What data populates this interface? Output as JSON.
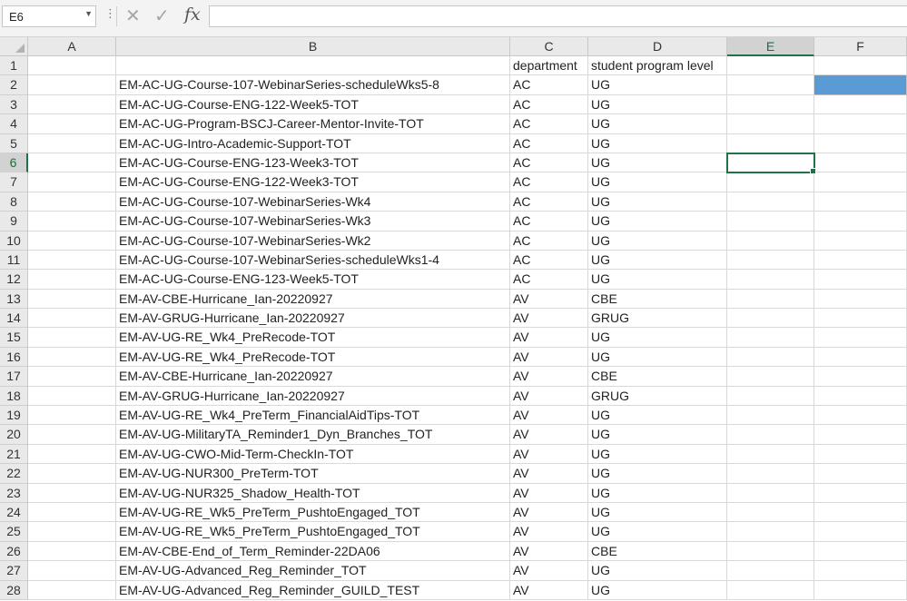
{
  "formula_bar": {
    "name_box": "E6",
    "formula": "",
    "icons": {
      "cancel": "cancel-x-icon",
      "enter": "enter-check-icon",
      "function": "insert-function-icon"
    },
    "cancel_glyph": "✕",
    "enter_glyph": "✓",
    "fx_glyph": "fx",
    "dots_glyph": "⋮"
  },
  "columns": [
    "A",
    "B",
    "C",
    "D",
    "E",
    "F"
  ],
  "selected_cell": {
    "column": "E",
    "row": 6
  },
  "colors": {
    "selection": "#217346",
    "fill_blue": "#5b9bd5"
  },
  "filled_cells": [
    {
      "column": "F",
      "row": 2,
      "color": "#5b9bd5"
    }
  ],
  "rows": [
    {
      "num": "1",
      "A": "",
      "B": "",
      "C": "department",
      "D": "student program level",
      "E": "",
      "F": ""
    },
    {
      "num": "2",
      "A": "",
      "B": "EM-AC-UG-Course-107-WebinarSeries-scheduleWks5-8",
      "C": "AC",
      "D": "UG",
      "E": "",
      "F": ""
    },
    {
      "num": "3",
      "A": "",
      "B": "EM-AC-UG-Course-ENG-122-Week5-TOT",
      "C": "AC",
      "D": "UG",
      "E": "",
      "F": ""
    },
    {
      "num": "4",
      "A": "",
      "B": "EM-AC-UG-Program-BSCJ-Career-Mentor-Invite-TOT",
      "C": "AC",
      "D": "UG",
      "E": "",
      "F": ""
    },
    {
      "num": "5",
      "A": "",
      "B": "EM-AC-UG-Intro-Academic-Support-TOT",
      "C": "AC",
      "D": "UG",
      "E": "",
      "F": ""
    },
    {
      "num": "6",
      "A": "",
      "B": "EM-AC-UG-Course-ENG-123-Week3-TOT",
      "C": "AC",
      "D": "UG",
      "E": "",
      "F": ""
    },
    {
      "num": "7",
      "A": "",
      "B": "EM-AC-UG-Course-ENG-122-Week3-TOT",
      "C": "AC",
      "D": "UG",
      "E": "",
      "F": ""
    },
    {
      "num": "8",
      "A": "",
      "B": "EM-AC-UG-Course-107-WebinarSeries-Wk4",
      "C": "AC",
      "D": "UG",
      "E": "",
      "F": ""
    },
    {
      "num": "9",
      "A": "",
      "B": "EM-AC-UG-Course-107-WebinarSeries-Wk3",
      "C": "AC",
      "D": "UG",
      "E": "",
      "F": ""
    },
    {
      "num": "10",
      "A": "",
      "B": "EM-AC-UG-Course-107-WebinarSeries-Wk2",
      "C": "AC",
      "D": "UG",
      "E": "",
      "F": ""
    },
    {
      "num": "11",
      "A": "",
      "B": "EM-AC-UG-Course-107-WebinarSeries-scheduleWks1-4",
      "C": "AC",
      "D": "UG",
      "E": "",
      "F": ""
    },
    {
      "num": "12",
      "A": "",
      "B": "EM-AC-UG-Course-ENG-123-Week5-TOT",
      "C": "AC",
      "D": "UG",
      "E": "",
      "F": ""
    },
    {
      "num": "13",
      "A": "",
      "B": "EM-AV-CBE-Hurricane_Ian-20220927",
      "C": "AV",
      "D": "CBE",
      "E": "",
      "F": ""
    },
    {
      "num": "14",
      "A": "",
      "B": "EM-AV-GRUG-Hurricane_Ian-20220927",
      "C": "AV",
      "D": "GRUG",
      "E": "",
      "F": ""
    },
    {
      "num": "15",
      "A": "",
      "B": "EM-AV-UG-RE_Wk4_PreRecode-TOT",
      "C": "AV",
      "D": "UG",
      "E": "",
      "F": ""
    },
    {
      "num": "16",
      "A": "",
      "B": "EM-AV-UG-RE_Wk4_PreRecode-TOT",
      "C": "AV",
      "D": "UG",
      "E": "",
      "F": ""
    },
    {
      "num": "17",
      "A": "",
      "B": "EM-AV-CBE-Hurricane_Ian-20220927",
      "C": "AV",
      "D": "CBE",
      "E": "",
      "F": ""
    },
    {
      "num": "18",
      "A": "",
      "B": "EM-AV-GRUG-Hurricane_Ian-20220927",
      "C": "AV",
      "D": "GRUG",
      "E": "",
      "F": ""
    },
    {
      "num": "19",
      "A": "",
      "B": "EM-AV-UG-RE_Wk4_PreTerm_FinancialAidTips-TOT",
      "C": "AV",
      "D": "UG",
      "E": "",
      "F": ""
    },
    {
      "num": "20",
      "A": "",
      "B": "EM-AV-UG-MilitaryTA_Reminder1_Dyn_Branches_TOT",
      "C": "AV",
      "D": "UG",
      "E": "",
      "F": ""
    },
    {
      "num": "21",
      "A": "",
      "B": "EM-AV-UG-CWO-Mid-Term-CheckIn-TOT",
      "C": "AV",
      "D": "UG",
      "E": "",
      "F": ""
    },
    {
      "num": "22",
      "A": "",
      "B": "EM-AV-UG-NUR300_PreTerm-TOT",
      "C": "AV",
      "D": "UG",
      "E": "",
      "F": ""
    },
    {
      "num": "23",
      "A": "",
      "B": "EM-AV-UG-NUR325_Shadow_Health-TOT",
      "C": "AV",
      "D": "UG",
      "E": "",
      "F": ""
    },
    {
      "num": "24",
      "A": "",
      "B": "EM-AV-UG-RE_Wk5_PreTerm_PushtoEngaged_TOT",
      "C": "AV",
      "D": "UG",
      "E": "",
      "F": ""
    },
    {
      "num": "25",
      "A": "",
      "B": "EM-AV-UG-RE_Wk5_PreTerm_PushtoEngaged_TOT",
      "C": "AV",
      "D": "UG",
      "E": "",
      "F": ""
    },
    {
      "num": "26",
      "A": "",
      "B": "EM-AV-CBE-End_of_Term_Reminder-22DA06",
      "C": "AV",
      "D": "CBE",
      "E": "",
      "F": ""
    },
    {
      "num": "27",
      "A": "",
      "B": "EM-AV-UG-Advanced_Reg_Reminder_TOT",
      "C": "AV",
      "D": "UG",
      "E": "",
      "F": ""
    },
    {
      "num": "28",
      "A": "",
      "B": "EM-AV-UG-Advanced_Reg_Reminder_GUILD_TEST",
      "C": "AV",
      "D": "UG",
      "E": "",
      "F": ""
    }
  ]
}
